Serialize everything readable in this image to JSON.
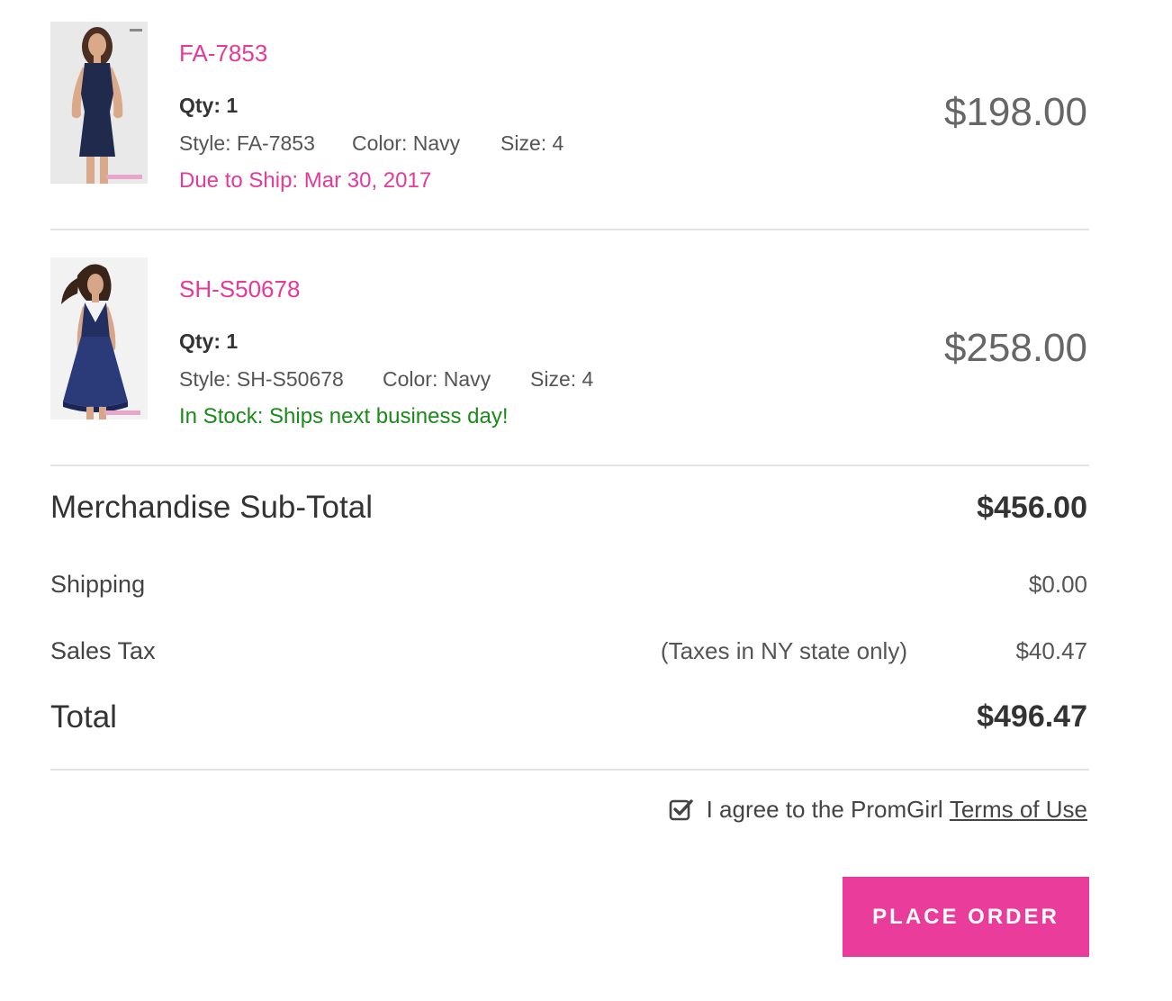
{
  "items": [
    {
      "name": "FA-7853",
      "qty": "Qty: 1",
      "style": "Style: FA-7853",
      "color": "Color: Navy",
      "size": "Size: 4",
      "shipping_note": "Due to Ship: Mar 30, 2017",
      "shipping_status": "due",
      "price": "$198.00"
    },
    {
      "name": "SH-S50678",
      "qty": "Qty: 1",
      "style": "Style: SH-S50678",
      "color": "Color: Navy",
      "size": "Size: 4",
      "shipping_note": "In Stock: Ships next business day!",
      "shipping_status": "in-stock",
      "price": "$258.00"
    }
  ],
  "summary": {
    "subtotal_label": "Merchandise Sub-Total",
    "subtotal_value": "$456.00",
    "shipping_label": "Shipping",
    "shipping_value": "$0.00",
    "tax_label": "Sales Tax",
    "tax_note": "(Taxes in NY state only)",
    "tax_value": "$40.47",
    "total_label": "Total",
    "total_value": "$496.47"
  },
  "agreement": {
    "text": "I agree to the PromGirl ",
    "link_text": "Terms of Use",
    "checked": true
  },
  "place_order_label": "PLACE ORDER",
  "colors": {
    "accent_pink": "#e5399b",
    "in_stock_green": "#1a8a1a",
    "button_pink": "#ea3c9b",
    "dress_navy": "#1f2a4d"
  },
  "icons": {
    "checkbox": "checkbox-checked-icon"
  }
}
